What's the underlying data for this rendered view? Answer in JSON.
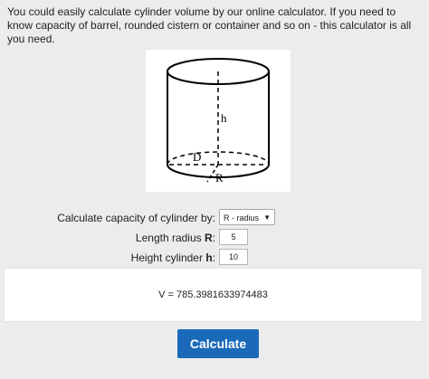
{
  "intro_text": "You could easily calculate cylinder volume by our online calculator. If you need to know capacity of barrel, rounded cistern or container and so on - this calculator is all you need.",
  "diagram": {
    "label_h": "h",
    "label_d": "D",
    "label_r": "R"
  },
  "form": {
    "calc_by_label": "Calculate capacity of cylinder by:",
    "calc_by_value": "R - radius",
    "radius_label": "Length radius ",
    "radius_symbol": "R",
    "radius_suffix": ":",
    "radius_value": "5",
    "height_label": "Height cylinder ",
    "height_symbol": "h",
    "height_suffix": ":",
    "height_value": "10"
  },
  "result_text": "V = 785.3981633974483",
  "calculate_button": "Calculate",
  "colors": {
    "button": "#1b6ab9",
    "background": "#ececec"
  }
}
